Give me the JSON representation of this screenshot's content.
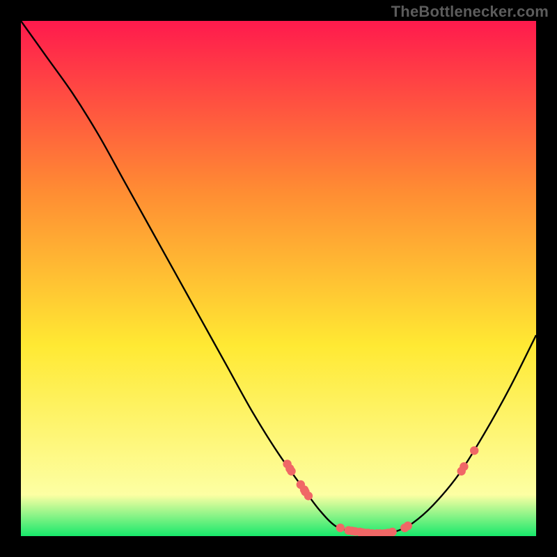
{
  "watermark": "TheBottlenecker.com",
  "chart_data": {
    "type": "line",
    "title": "",
    "xlabel": "",
    "ylabel": "",
    "xlim": [
      0,
      100
    ],
    "ylim": [
      0,
      100
    ],
    "grid": false,
    "gradient": {
      "top": "#ff1a4d",
      "mid_upper": "#ff8c33",
      "mid": "#ffe933",
      "low": "#fdffa3",
      "base": "#17e86b"
    },
    "curve_color": "#000000",
    "marker_color": "#f06766",
    "curve": [
      {
        "x": 0,
        "y": 100
      },
      {
        "x": 5,
        "y": 93
      },
      {
        "x": 10,
        "y": 86
      },
      {
        "x": 15,
        "y": 78
      },
      {
        "x": 20,
        "y": 69
      },
      {
        "x": 25,
        "y": 60
      },
      {
        "x": 30,
        "y": 51
      },
      {
        "x": 35,
        "y": 42
      },
      {
        "x": 40,
        "y": 33
      },
      {
        "x": 45,
        "y": 24
      },
      {
        "x": 50,
        "y": 16
      },
      {
        "x": 55,
        "y": 9
      },
      {
        "x": 58,
        "y": 5
      },
      {
        "x": 61,
        "y": 2
      },
      {
        "x": 64,
        "y": 1
      },
      {
        "x": 67,
        "y": 0.6
      },
      {
        "x": 70,
        "y": 0.5
      },
      {
        "x": 73,
        "y": 1
      },
      {
        "x": 76,
        "y": 2.5
      },
      {
        "x": 80,
        "y": 6
      },
      {
        "x": 85,
        "y": 12
      },
      {
        "x": 90,
        "y": 20
      },
      {
        "x": 95,
        "y": 29
      },
      {
        "x": 100,
        "y": 39
      }
    ],
    "markers": [
      {
        "x": 51.7,
        "y": 14.0
      },
      {
        "x": 52.2,
        "y": 13.1
      },
      {
        "x": 52.5,
        "y": 12.6
      },
      {
        "x": 54.3,
        "y": 10.0
      },
      {
        "x": 55.0,
        "y": 9.0
      },
      {
        "x": 55.2,
        "y": 8.6
      },
      {
        "x": 55.8,
        "y": 7.8
      },
      {
        "x": 62.0,
        "y": 1.6
      },
      {
        "x": 63.6,
        "y": 1.1
      },
      {
        "x": 64.3,
        "y": 1.0
      },
      {
        "x": 64.9,
        "y": 0.9
      },
      {
        "x": 65.8,
        "y": 0.8
      },
      {
        "x": 66.3,
        "y": 0.7
      },
      {
        "x": 66.9,
        "y": 0.6
      },
      {
        "x": 67.4,
        "y": 0.6
      },
      {
        "x": 68.2,
        "y": 0.5
      },
      {
        "x": 69.1,
        "y": 0.5
      },
      {
        "x": 69.7,
        "y": 0.5
      },
      {
        "x": 70.5,
        "y": 0.5
      },
      {
        "x": 71.2,
        "y": 0.6
      },
      {
        "x": 71.6,
        "y": 0.6
      },
      {
        "x": 72.1,
        "y": 0.8
      },
      {
        "x": 74.5,
        "y": 1.6
      },
      {
        "x": 75.1,
        "y": 2.0
      },
      {
        "x": 85.5,
        "y": 12.6
      },
      {
        "x": 86.0,
        "y": 13.5
      },
      {
        "x": 88.0,
        "y": 16.6
      }
    ]
  }
}
